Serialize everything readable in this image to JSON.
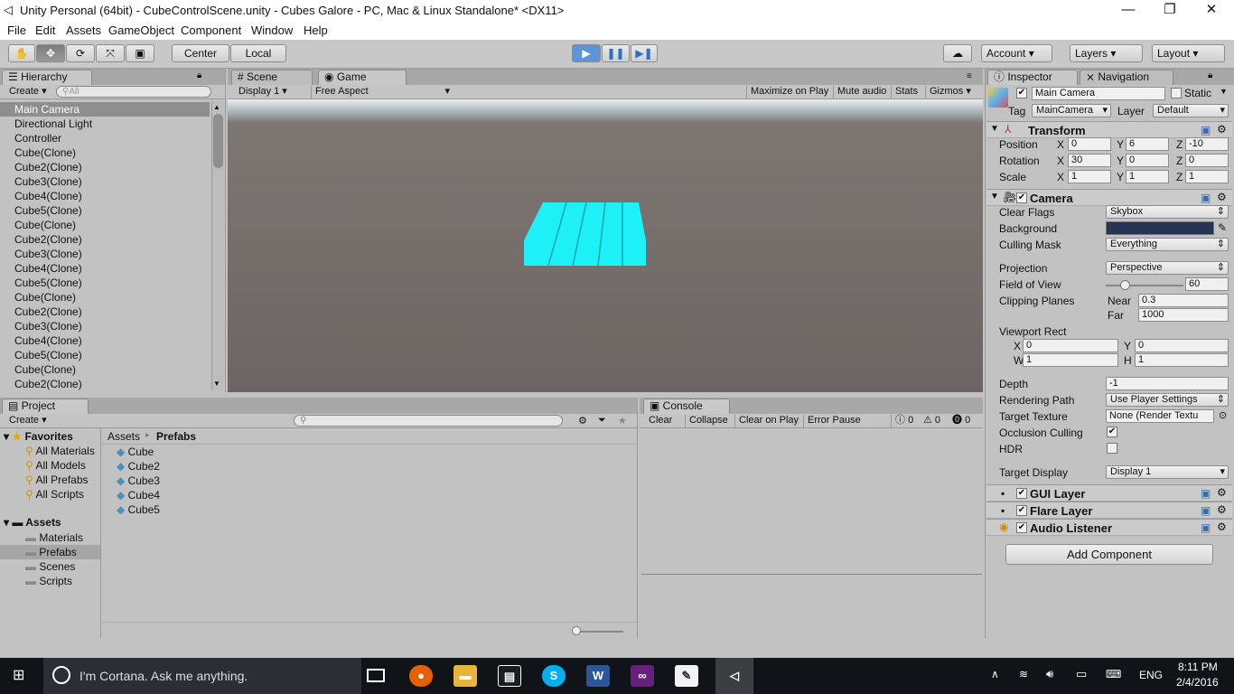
{
  "window": {
    "title": "Unity Personal (64bit) - CubeControlScene.unity - Cubes Galore - PC, Mac & Linux Standalone* <DX11>",
    "min": "—",
    "max": "❐",
    "close": "✕"
  },
  "menu": [
    "File",
    "Edit",
    "Assets",
    "GameObject",
    "Component",
    "Window",
    "Help"
  ],
  "toolbar": {
    "pivot": "Center",
    "space": "Local",
    "account": "Account",
    "layers": "Layers",
    "layout": "Layout"
  },
  "hierarchy": {
    "tab": "Hierarchy",
    "create": "Create",
    "search_placeholder": "All",
    "items": [
      "Main Camera",
      "Directional Light",
      "Controller",
      "Cube(Clone)",
      "Cube2(Clone)",
      "Cube3(Clone)",
      "Cube4(Clone)",
      "Cube5(Clone)",
      "Cube(Clone)",
      "Cube2(Clone)",
      "Cube3(Clone)",
      "Cube4(Clone)",
      "Cube5(Clone)",
      "Cube(Clone)",
      "Cube2(Clone)",
      "Cube3(Clone)",
      "Cube4(Clone)",
      "Cube5(Clone)",
      "Cube(Clone)",
      "Cube2(Clone)"
    ]
  },
  "game": {
    "tab_scene": "Scene",
    "tab_game": "Game",
    "display": "Display 1",
    "aspect": "Free Aspect",
    "maximize": "Maximize on Play",
    "mute": "Mute audio",
    "stats": "Stats",
    "gizmos": "Gizmos",
    "cube_color": "#1ef0f8"
  },
  "project": {
    "tab": "Project",
    "create": "Create",
    "favorites_label": "Favorites",
    "favorites": [
      "All Materials",
      "All Models",
      "All Prefabs",
      "All Scripts"
    ],
    "assets_label": "Assets",
    "folders": [
      "Materials",
      "Prefabs",
      "Scenes",
      "Scripts"
    ],
    "breadcrumb_root": "Assets",
    "breadcrumb_sep": "▸",
    "breadcrumb_current": "Prefabs",
    "files": [
      "Cube",
      "Cube2",
      "Cube3",
      "Cube4",
      "Cube5"
    ]
  },
  "console": {
    "tab": "Console",
    "clear": "Clear",
    "collapse": "Collapse",
    "clear_on_play": "Clear on Play",
    "error_pause": "Error Pause",
    "count_info": "0",
    "count_warn": "0",
    "count_err": "0"
  },
  "inspector": {
    "tab": "Inspector",
    "nav_tab": "Navigation",
    "object_name": "Main Camera",
    "static": "Static",
    "tag_label": "Tag",
    "tag": "MainCamera",
    "layer_label": "Layer",
    "layer": "Default",
    "transform": {
      "title": "Transform",
      "position_label": "Position",
      "rotation_label": "Rotation",
      "scale_label": "Scale",
      "position": [
        "0",
        "6",
        "-10"
      ],
      "rotation": [
        "30",
        "0",
        "0"
      ],
      "scale": [
        "1",
        "1",
        "1"
      ]
    },
    "camera": {
      "title": "Camera",
      "clear_flags_label": "Clear Flags",
      "clear_flags": "Skybox",
      "background_label": "Background",
      "background_color": "#243452",
      "culling_mask_label": "Culling Mask",
      "culling_mask": "Everything",
      "projection_label": "Projection",
      "projection": "Perspective",
      "fov_label": "Field of View",
      "fov": "60",
      "fov_slider_fraction": 0.19,
      "clipping_label": "Clipping Planes",
      "near_label": "Near",
      "near": "0.3",
      "far_label": "Far",
      "far": "1000",
      "viewport_label": "Viewport Rect",
      "vx": "0",
      "vy": "0",
      "vw": "1",
      "vh": "1",
      "depth_label": "Depth",
      "depth": "-1",
      "rendering_path_label": "Rendering Path",
      "rendering_path": "Use Player Settings",
      "target_texture_label": "Target Texture",
      "target_texture": "None (Render Textu",
      "occlusion_label": "Occlusion Culling",
      "hdr_label": "HDR",
      "target_display_label": "Target Display",
      "target_display": "Display 1"
    },
    "components": [
      "GUI Layer",
      "Flare Layer",
      "Audio Listener"
    ],
    "add_component": "Add Component"
  },
  "axes": {
    "x": "X",
    "y": "Y",
    "z": "Z",
    "w": "W",
    "h": "H"
  },
  "taskbar": {
    "search": "I'm Cortana. Ask me anything.",
    "lang": "ENG",
    "time": "8:11 PM",
    "date": "2/4/2016"
  }
}
